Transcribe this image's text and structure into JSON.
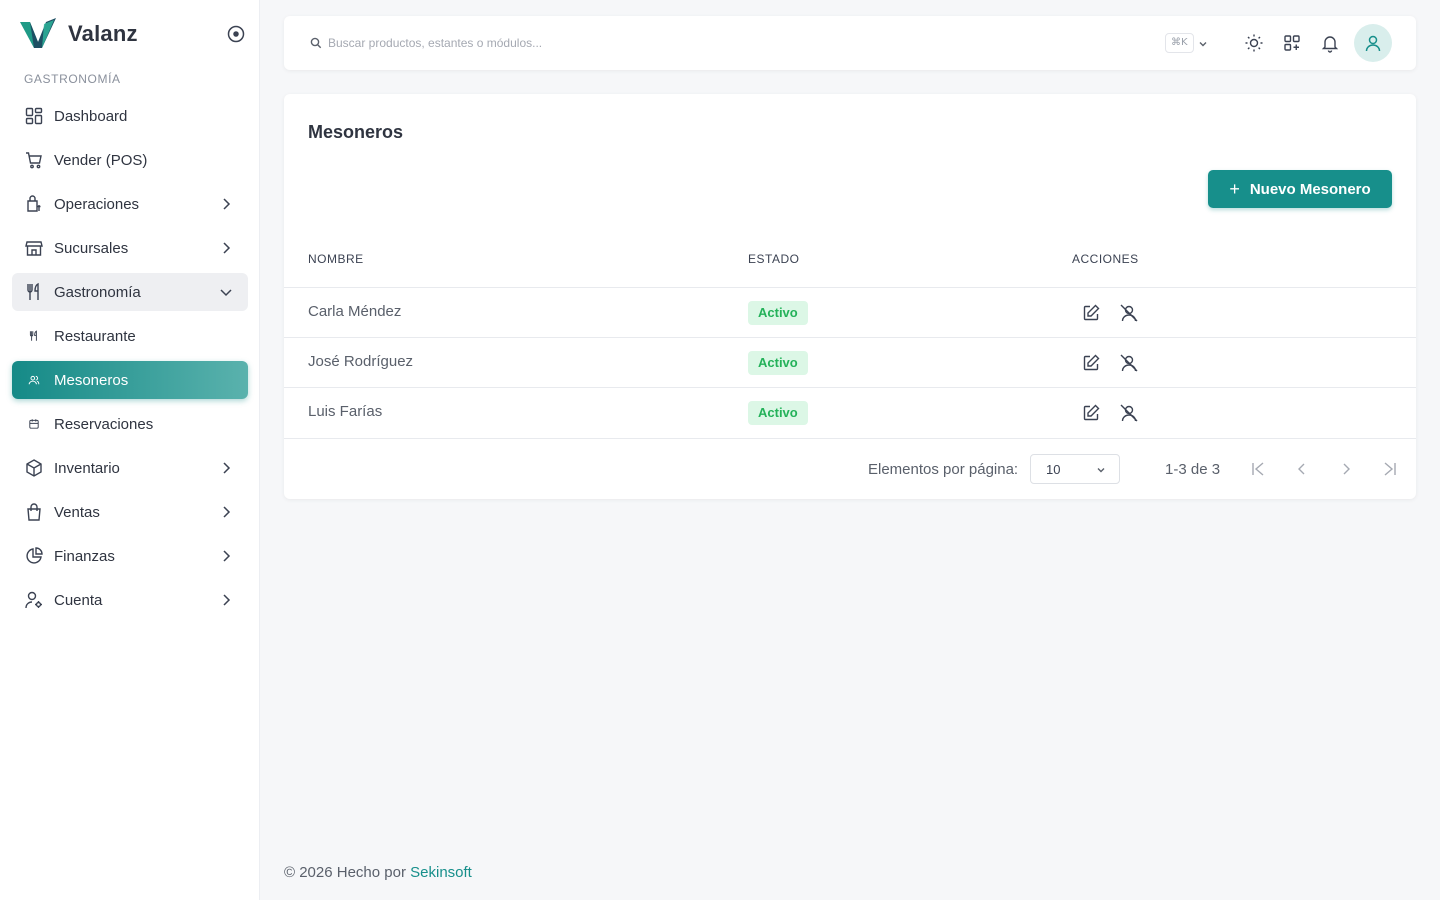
{
  "app": {
    "name": "Valanz"
  },
  "sidebar": {
    "section_label": "GASTRONOMÍA",
    "items": [
      {
        "label": "Dashboard",
        "icon": "dashboard-icon"
      },
      {
        "label": "Vender (POS)",
        "icon": "cart-icon"
      },
      {
        "label": "Operaciones",
        "icon": "operations-icon",
        "expandable": true
      },
      {
        "label": "Sucursales",
        "icon": "store-icon",
        "expandable": true
      },
      {
        "label": "Gastronomía",
        "icon": "utensils-icon",
        "expandable": true,
        "expanded": true
      },
      {
        "label": "Restaurante",
        "icon": "utensils-small-icon",
        "sub": true
      },
      {
        "label": "Mesoneros",
        "icon": "users-small-icon",
        "sub": true,
        "active": true
      },
      {
        "label": "Reservaciones",
        "icon": "calendar-small-icon",
        "sub": true
      },
      {
        "label": "Inventario",
        "icon": "box-icon",
        "expandable": true
      },
      {
        "label": "Ventas",
        "icon": "bag-icon",
        "expandable": true
      },
      {
        "label": "Finanzas",
        "icon": "pie-chart-icon",
        "expandable": true
      },
      {
        "label": "Cuenta",
        "icon": "user-settings-icon",
        "expandable": true
      }
    ]
  },
  "topbar": {
    "search_placeholder": "Buscar productos, estantes o módulos...",
    "shortcut": "⌘K",
    "icons": [
      "sun-icon",
      "apps-icon",
      "bell-icon",
      "user-avatar-icon"
    ]
  },
  "page": {
    "title": "Mesoneros",
    "new_button": "Nuevo Mesonero",
    "columns": {
      "name": "NOMBRE",
      "status": "ESTADO",
      "actions": "ACCIONES"
    },
    "rows": [
      {
        "name": "Carla Méndez",
        "status": "Activo"
      },
      {
        "name": "José Rodríguez",
        "status": "Activo"
      },
      {
        "name": "Luis Farías",
        "status": "Activo"
      }
    ],
    "pagination": {
      "per_page_label": "Elementos por página:",
      "per_page": "10",
      "range": "1-3 de 3"
    }
  },
  "footer": {
    "text": "© 2026 Hecho por ",
    "link": "Sekinsoft"
  },
  "colors": {
    "accent": "#178f8b",
    "active_gradient_start": "#158a87",
    "active_gradient_end": "#5ab2ad",
    "badge_bg": "#dcf7e6",
    "badge_text": "#24b25a",
    "background": "#f6f7f9"
  }
}
